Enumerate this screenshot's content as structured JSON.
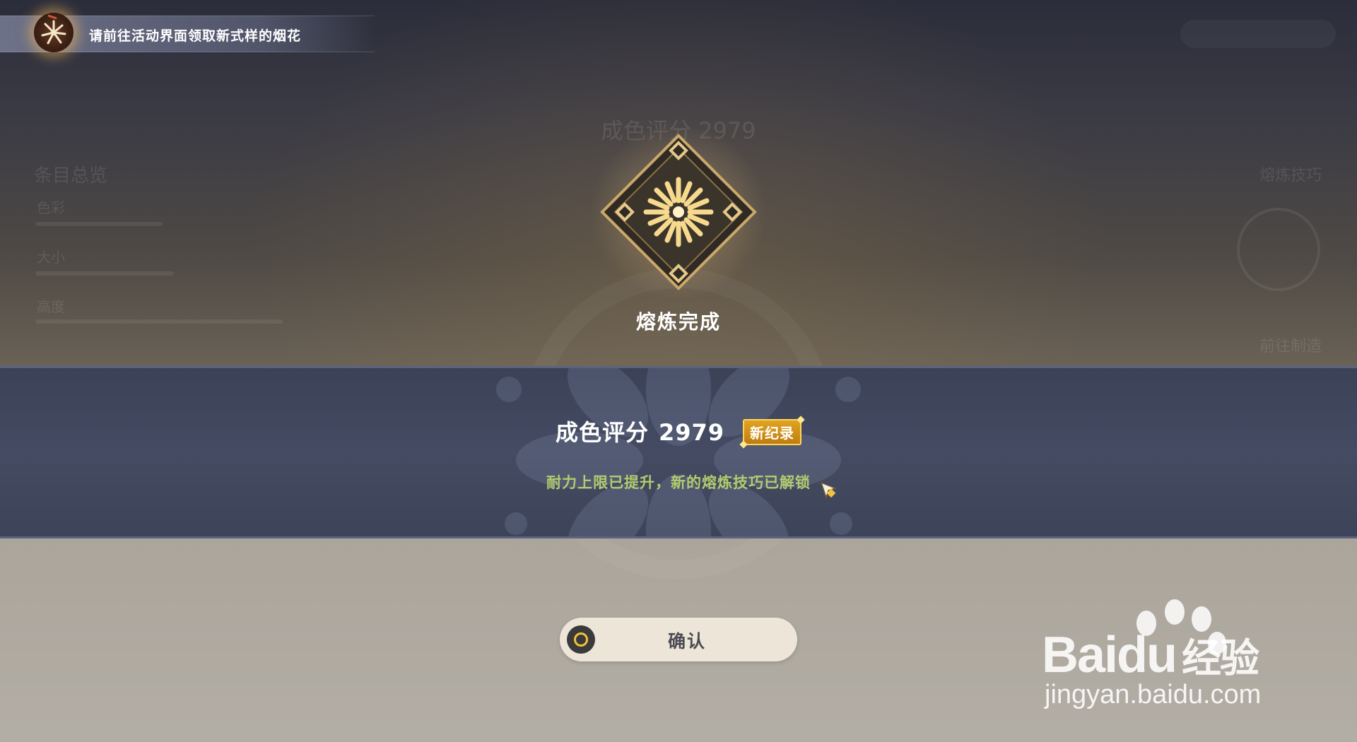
{
  "notification": {
    "text": "请前往活动界面领取新式样的烟花",
    "icon": "firework-icon"
  },
  "background_ui": {
    "score_text": "成色评分 2979",
    "list_title": "条目总览",
    "list_items": [
      "色彩",
      "大小",
      "高度"
    ],
    "right_label_top": "熔炼技巧",
    "right_label_bottom": "前往制造"
  },
  "result": {
    "title": "熔炼完成",
    "score_label": "成色评分",
    "score_value": "2979",
    "record_badge": "新纪录",
    "note": "耐力上限已提升，新的熔炼技巧已解锁"
  },
  "confirm": {
    "label": "确认",
    "icon": "controller-button-icon"
  },
  "watermark": {
    "brand": "Bai",
    "brand_suffix": "du",
    "chinese": "经验",
    "url": "jingyan.baidu.com"
  },
  "colors": {
    "band": "#444b62",
    "note_green": "#b2cc6e",
    "badge_gold": "#d89a18",
    "button_bg": "#ece5d8"
  }
}
